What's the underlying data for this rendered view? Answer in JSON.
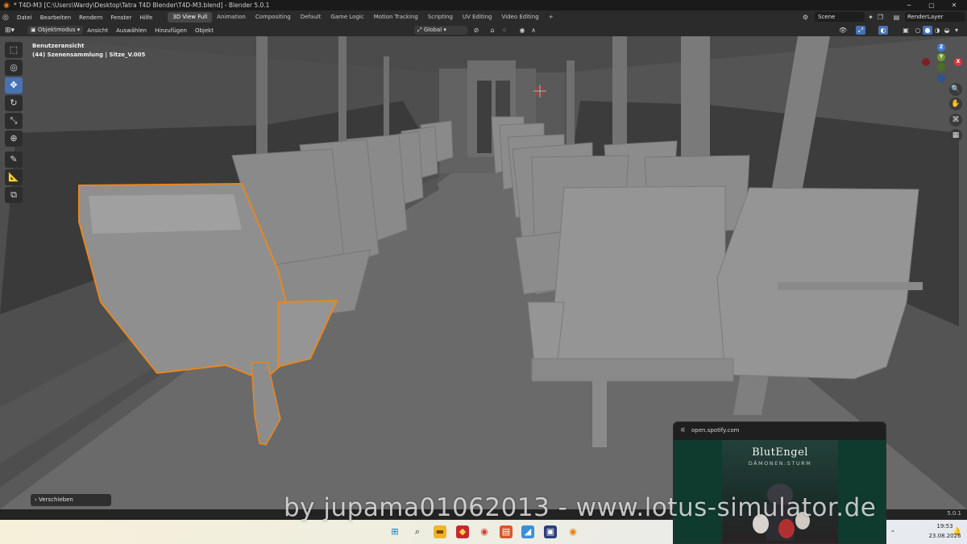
{
  "window": {
    "title": "* T4D-M3 [C:\\Users\\Wardy\\Desktop\\Tatra T4D Blender\\T4D-M3.blend] - Blender 5.0.1",
    "min_glyph": "─",
    "max_glyph": "▢",
    "close_glyph": "✕"
  },
  "menu": [
    "Datei",
    "Bearbeiten",
    "Rendern",
    "Fenster",
    "Hilfe"
  ],
  "workspaces": [
    "3D View Full",
    "Animation",
    "Compositing",
    "Default",
    "Game Logic",
    "Motion Tracking",
    "Scripting",
    "UV Editing",
    "Video Editing"
  ],
  "workspace_add": "+",
  "scene": "Scene",
  "view_layer": "RenderLayer",
  "viewport_header": {
    "mode": "Objektmodus",
    "menus": [
      "Ansicht",
      "Auswählen",
      "Hinzufügen",
      "Objekt"
    ],
    "transform_orientation": "Global"
  },
  "viewport": {
    "view_name": "Benutzeransicht",
    "collection_info": "(44) Szenensammlung | Sitze_V.005"
  },
  "gizmo": {
    "x": "X",
    "y": "Y",
    "z": "Z"
  },
  "operator_panel": "Verschieben",
  "status": {
    "version": "5.0.1"
  },
  "watermark": "by jupama01062013 - www.lotus-simulator.de",
  "taskbar": {
    "time": "19:53",
    "date": "23.08.2026"
  },
  "spotify": {
    "url": "open.spotify.com",
    "album_title": "BlutEngel",
    "album_subtitle": "DÄMONEN:STURM"
  },
  "colors": {
    "accent": "#4772b3",
    "selection": "#e8871e",
    "axis_x": "#e3333f",
    "axis_y": "#6e9e2b",
    "axis_z": "#3d80d6"
  }
}
